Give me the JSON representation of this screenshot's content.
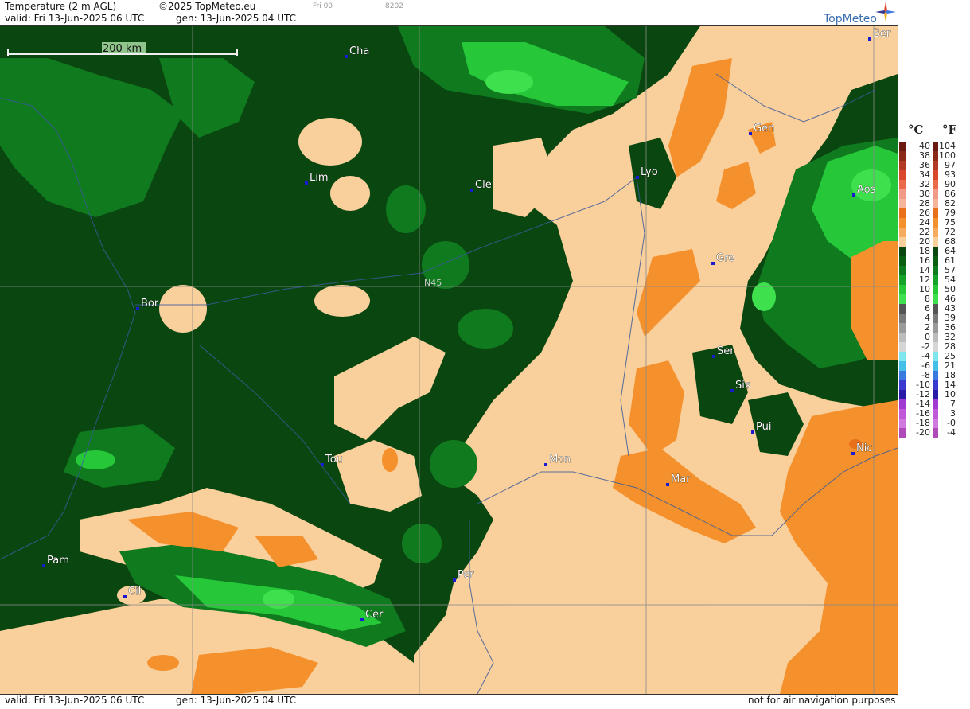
{
  "header": {
    "title": "Temperature (2 m AGL)",
    "copyright": "©2025 TopMeteo.eu",
    "model_run": "Fri 00",
    "code": "8202",
    "valid": "valid:  Fri  13-Jun-2025  06 UTC",
    "generated": "gen: 13-Jun-2025 04 UTC",
    "brand": "TopMeteo"
  },
  "footer": {
    "valid": "valid:  Fri  13-Jun-2025  06 UTC",
    "generated": "gen: 13-Jun-2025 04 UTC",
    "disclaimer": "not for air navigation purposes"
  },
  "map": {
    "scale_label": "200 km",
    "latitude_label": "N45",
    "cities": [
      "Cha",
      "Ber",
      "Gen",
      "Lim",
      "Cle",
      "Lyo",
      "Aos",
      "Gre",
      "Bor",
      "Ser",
      "Sis",
      "Pui",
      "Tou",
      "Mon",
      "Mar",
      "Nic",
      "Pam",
      "Per",
      "Cil",
      "Cer"
    ]
  },
  "legend": {
    "celsius_unit": "°C",
    "fahrenheit_unit": "°F",
    "celsius": [
      "40",
      "38",
      "36",
      "34",
      "32",
      "30",
      "28",
      "26",
      "24",
      "22",
      "20",
      "18",
      "16",
      "14",
      "12",
      "10",
      "8",
      "6",
      "4",
      "2",
      "0",
      "-2",
      "-4",
      "-6",
      "-8",
      "-10",
      "-12",
      "-14",
      "-16",
      "-18",
      "-20"
    ],
    "fahrenheit": [
      "104",
      "100",
      "97",
      "93",
      "90",
      "86",
      "82",
      "79",
      "75",
      "72",
      "68",
      "64",
      "61",
      "57",
      "54",
      "50",
      "46",
      "43",
      "39",
      "36",
      "32",
      "28",
      "25",
      "21",
      "18",
      "14",
      "10",
      "7",
      "3",
      "-0",
      "-4"
    ],
    "colors": {
      "warm": [
        "#6b1a12",
        "#8c2a1a",
        "#b33a24",
        "#d9482a",
        "#ea6a4a",
        "#f29a8a",
        "#f5b59a",
        "#e8701a",
        "#f5912c",
        "#f7ab5e",
        "#f9cf9c"
      ],
      "green": [
        "#0a4710",
        "#0b5d14",
        "#0f7a1e",
        "#16a32a",
        "#26c83a",
        "#3ee04e"
      ],
      "grey": [
        "#555555",
        "#7a7a7a",
        "#9a9a9a",
        "#bcbcbc",
        "#d6d6d6"
      ],
      "cold": [
        "#7fe6f0",
        "#43bfe8",
        "#3a7ae0",
        "#3a3ad0",
        "#2a1aa8",
        "#a03ad0",
        "#c05ad8",
        "#d07ae0",
        "#b04ab8",
        "#8a3a98"
      ]
    }
  }
}
